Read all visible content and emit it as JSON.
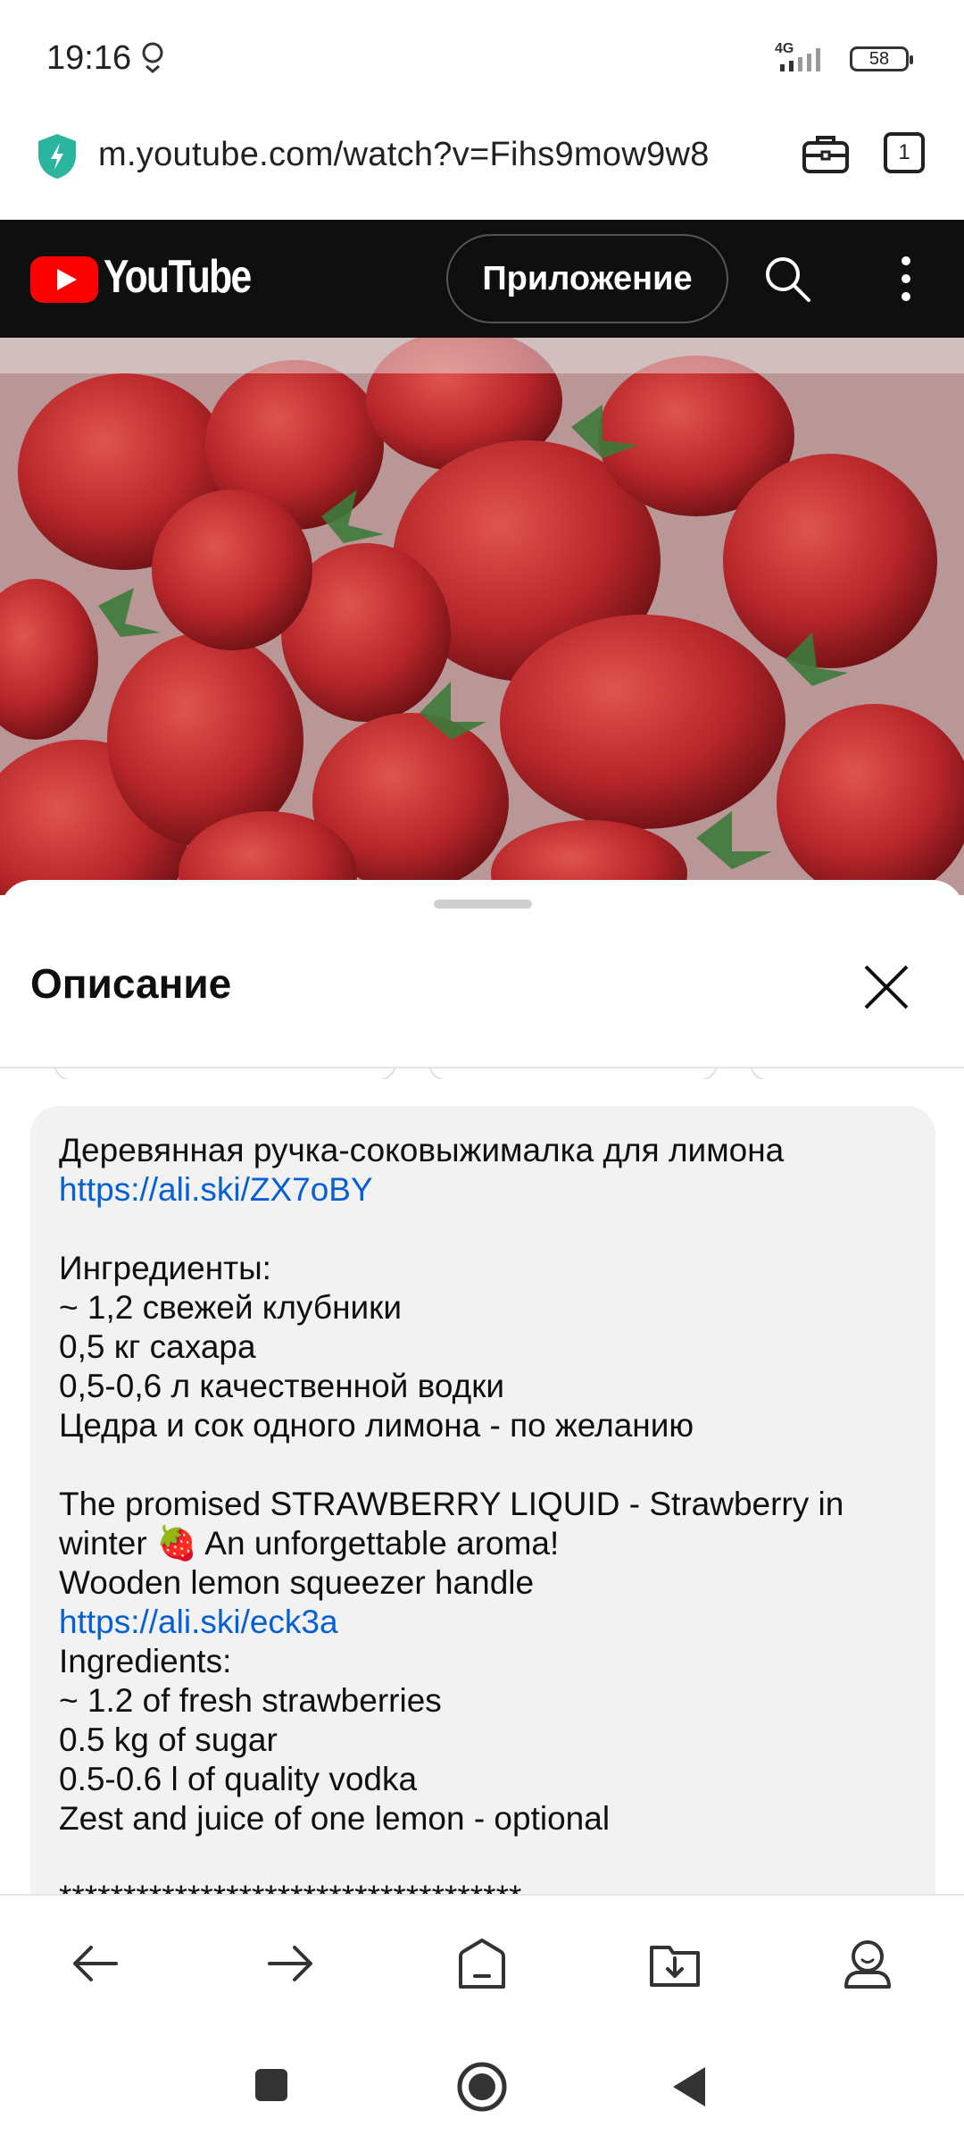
{
  "status_bar": {
    "time": "19:16",
    "network": "4G",
    "battery": "58"
  },
  "browser": {
    "url": "m.youtube.com/watch?v=Fihs9mow9w8",
    "tab_count": "1"
  },
  "youtube_header": {
    "logo_text": "YouTube",
    "app_button_label": "Приложение"
  },
  "description_sheet": {
    "title": "Описание",
    "lines": [
      {
        "text": "Деревянная ручка-соковыжималка для лимона",
        "link": false
      },
      {
        "text": "https://ali.ski/ZX7oBY",
        "link": true
      },
      {
        "text": "",
        "link": false
      },
      {
        "text": "Ингредиенты:",
        "link": false
      },
      {
        "text": "~ 1,2 свежей клубники",
        "link": false
      },
      {
        "text": "0,5 кг сахара",
        "link": false
      },
      {
        "text": "0,5-0,6 л качественной водки",
        "link": false
      },
      {
        "text": "Цедра и сок одного лимона - по желанию",
        "link": false
      },
      {
        "text": "",
        "link": false
      },
      {
        "text": "The promised STRAWBERRY LIQUID - Strawberry in",
        "link": false
      },
      {
        "text": "winter 🍓 An unforgettable aroma!",
        "link": false
      },
      {
        "text": "Wooden lemon squeezer handle",
        "link": false
      },
      {
        "text": "https://ali.ski/eck3a",
        "link": true
      },
      {
        "text": "Ingredients:",
        "link": false
      },
      {
        "text": "~ 1.2 of fresh strawberries",
        "link": false
      },
      {
        "text": "0.5 kg of sugar",
        "link": false
      },
      {
        "text": "0.5-0.6 l of quality vodka",
        "link": false
      },
      {
        "text": "Zest and juice of one lemon - optional",
        "link": false
      },
      {
        "text": "",
        "link": false
      },
      {
        "text": "************************************",
        "link": false
      }
    ]
  },
  "colors": {
    "yt_red": "#ff0000",
    "link": "#065fd4",
    "shield": "#2bb5a0"
  },
  "icons": {
    "bottom_nav": [
      "back-arrow-icon",
      "forward-arrow-icon",
      "home-icon",
      "downloads-icon",
      "profile-icon"
    ],
    "system_nav": [
      "recents-square-icon",
      "home-circle-icon",
      "back-triangle-icon"
    ]
  }
}
